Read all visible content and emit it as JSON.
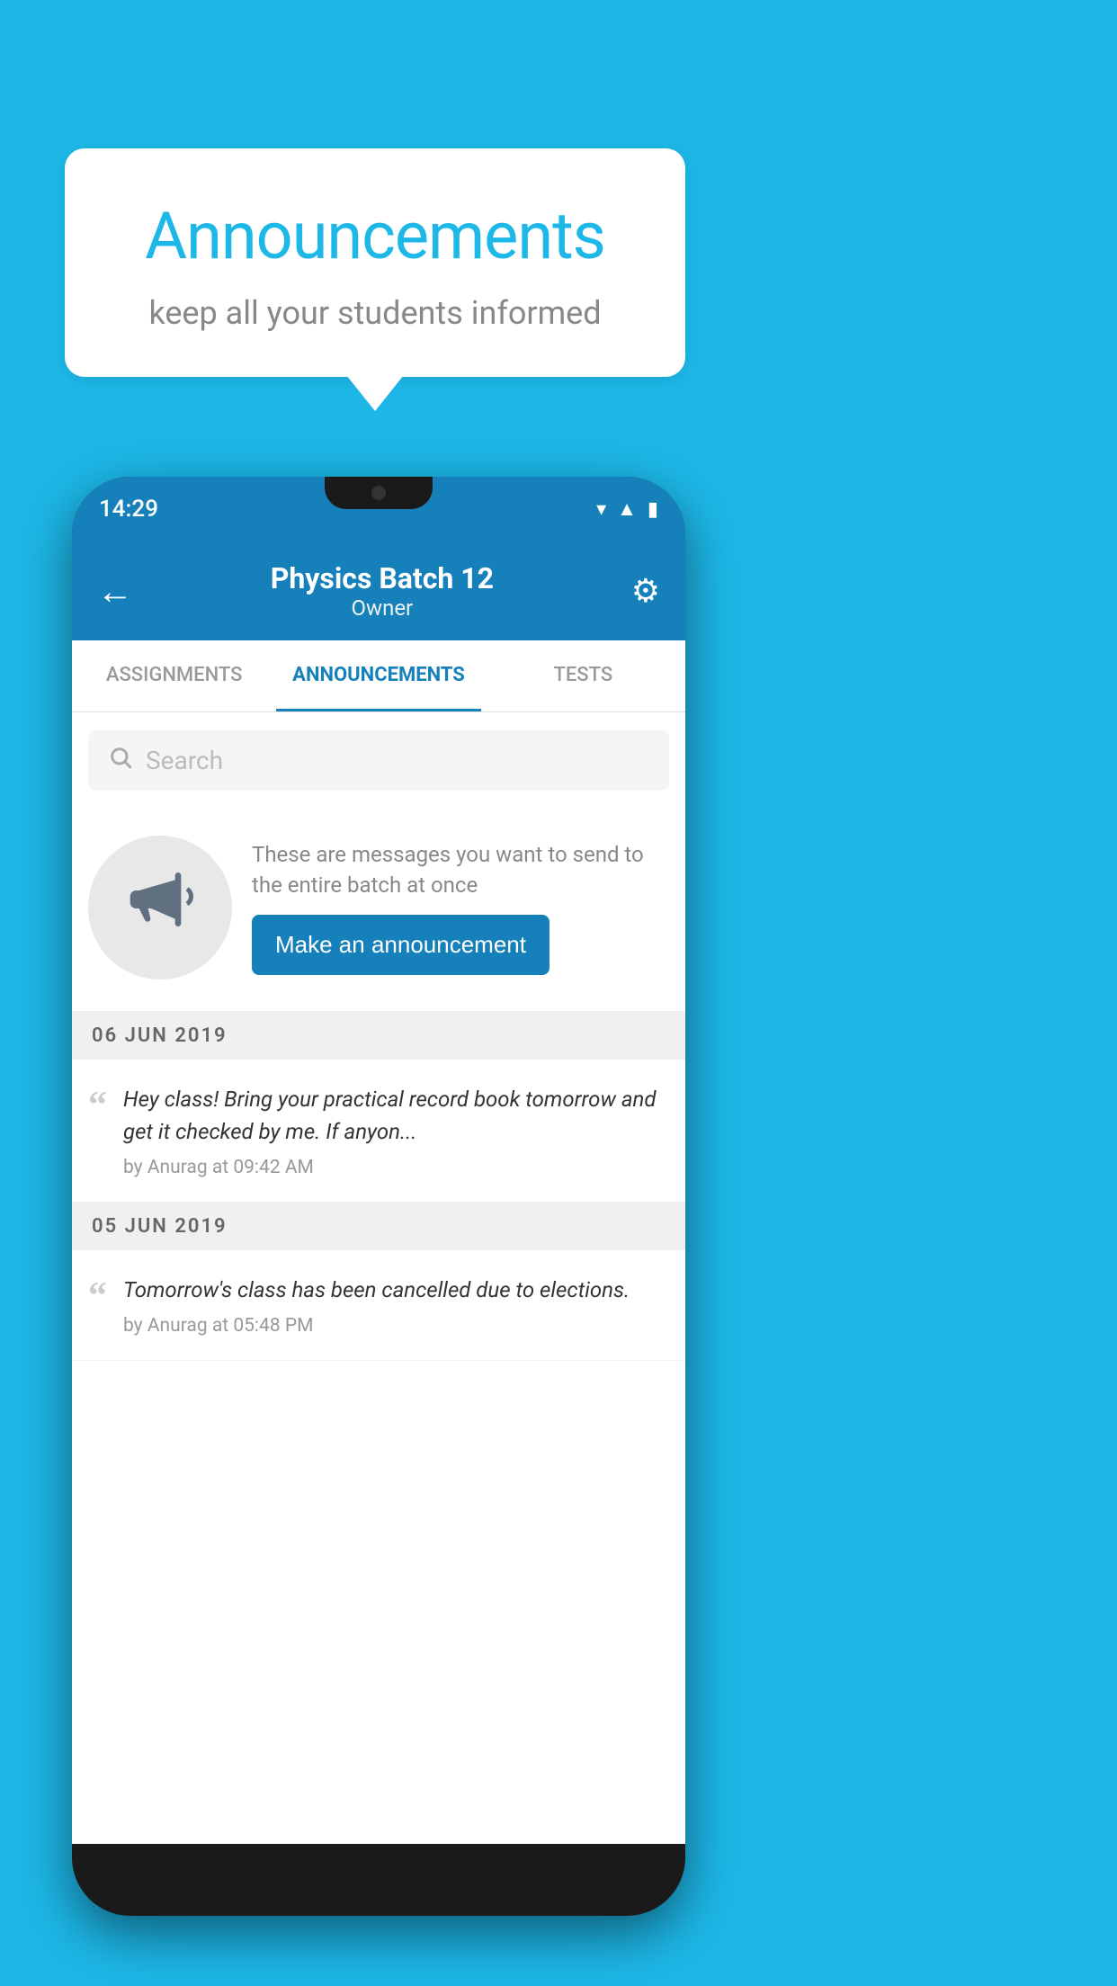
{
  "background_color": "#1DB8E8",
  "speech_bubble": {
    "title": "Announcements",
    "subtitle": "keep all your students informed"
  },
  "phone": {
    "status_bar": {
      "time": "14:29"
    },
    "header": {
      "title": "Physics Batch 12",
      "subtitle": "Owner",
      "back_label": "←",
      "gear_label": "⚙"
    },
    "tabs": [
      {
        "label": "ASSIGNMENTS",
        "active": false
      },
      {
        "label": "ANNOUNCEMENTS",
        "active": true
      },
      {
        "label": "TESTS",
        "active": false
      }
    ],
    "search": {
      "placeholder": "Search"
    },
    "promo": {
      "description": "These are messages you want to send to the entire batch at once",
      "button_label": "Make an announcement"
    },
    "announcements": [
      {
        "date": "06  JUN  2019",
        "text": "Hey class! Bring your practical record book tomorrow and get it checked by me. If anyon...",
        "meta": "by Anurag at 09:42 AM"
      },
      {
        "date": "05  JUN  2019",
        "text": "Tomorrow's class has been cancelled due to elections.",
        "meta": "by Anurag at 05:48 PM"
      }
    ]
  }
}
